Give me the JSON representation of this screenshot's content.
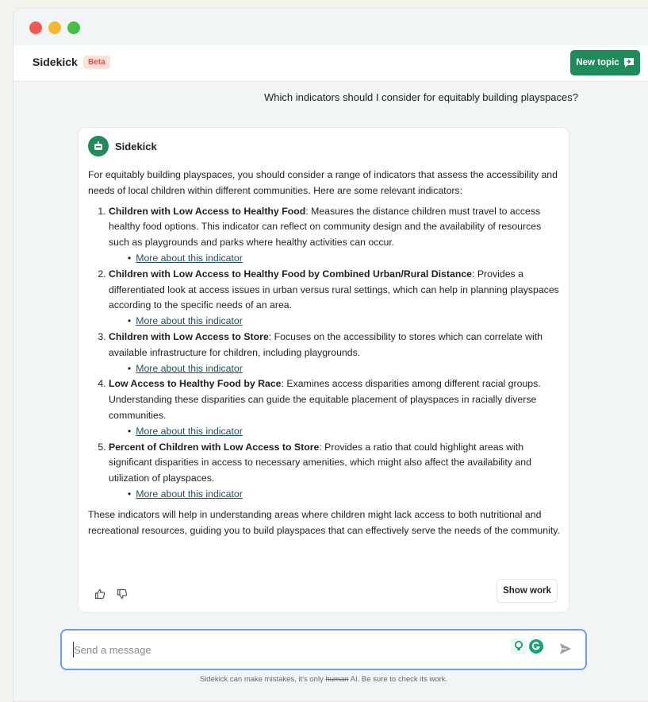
{
  "app": {
    "brand": "Sidekick",
    "badge": "Beta",
    "new_topic_label": "New topic"
  },
  "conversation": {
    "user_message": "Which indicators should I consider for equitably building playspaces?",
    "bot_name": "Sidekick",
    "intro": "For equitably building playspaces, you should consider a range of indicators that assess the accessibility and needs of local children within different communities. Here are some relevant indicators:",
    "indicators": [
      {
        "title": "Children with Low Access to Healthy Food",
        "description": ": Measures the distance children must travel to access healthy food options. This indicator can reflect on community design and the availability of resources such as playgrounds and parks where healthy activities can occur.",
        "link": "More about this indicator"
      },
      {
        "title": "Children with Low Access to Healthy Food by Combined Urban/Rural Distance",
        "description": ": Provides a differentiated look at access issues in urban versus rural settings, which can help in planning playspaces according to the specific needs of an area.",
        "link": "More about this indicator"
      },
      {
        "title": "Children with Low Access to Store",
        "description": ": Focuses on the accessibility to stores which can correlate with available infrastructure for children, including playgrounds.",
        "link": "More about this indicator"
      },
      {
        "title": "Low Access to Healthy Food by Race",
        "description": ": Examines access disparities among different racial groups. Understanding these disparities can guide the equitable placement of playspaces in racially diverse communities.",
        "link": "More about this indicator"
      },
      {
        "title": "Percent of Children with Low Access to Store",
        "description": ": Provides a ratio that could highlight areas with significant disparities in access to necessary amenities, which might also affect the availability and utilization of playspaces.",
        "link": "More about this indicator"
      }
    ],
    "outro": "These indicators will help in understanding areas where children might lack access to both nutritional and recreational resources, guiding you to build playspaces that can effectively serve the needs of the community.",
    "show_work_label": "Show work"
  },
  "composer": {
    "placeholder": "Send a message",
    "disclaimer_before": "Sidekick can make mistakes, it's only ",
    "disclaimer_struck": "human",
    "disclaimer_after": " AI. Be sure to check its work."
  },
  "colors": {
    "accent": "#1f8a5a",
    "badge_bg": "#fde2dc",
    "badge_text": "#d5544a",
    "composer_border": "#6f9ee8"
  },
  "icons": {
    "new_topic": "chat-plus-icon",
    "bot_avatar": "robot-icon",
    "thumbs_up": "thumbs-up-icon",
    "thumbs_down": "thumbs-down-icon",
    "ext1": "lightbulb-extension-icon",
    "ext2": "grammarly-icon",
    "send": "send-icon"
  }
}
